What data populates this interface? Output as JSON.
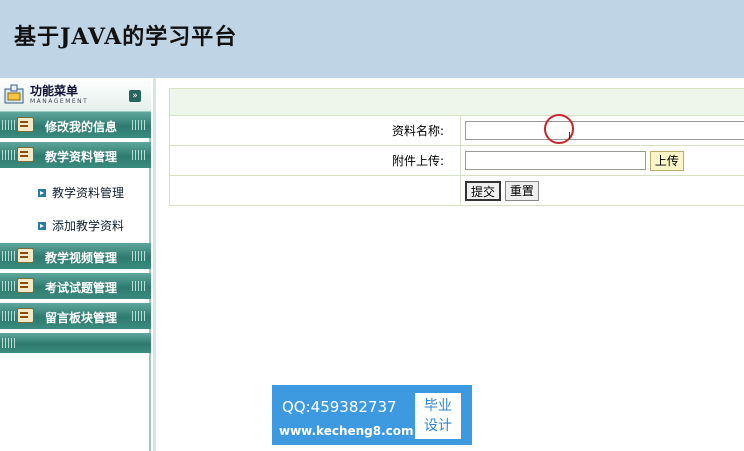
{
  "header": {
    "title": "基于JAVA的学习平台"
  },
  "menu": {
    "title": "功能菜单",
    "subtitle": "MANAGEMENT",
    "collapse_icon": "chevron-down-icon"
  },
  "sidebar": {
    "sections": [
      {
        "label": "修改我的信息"
      },
      {
        "label": "教学资料管理"
      },
      {
        "label": "教学视频管理"
      },
      {
        "label": "考试试题管理"
      },
      {
        "label": "留言板块管理"
      }
    ],
    "sub_items": [
      {
        "label": "教学资料管理"
      },
      {
        "label": "添加教学资料"
      }
    ]
  },
  "form": {
    "name_label": "资料名称:",
    "name_value": "",
    "attachment_label": "附件上传:",
    "attachment_value": "",
    "upload_button": "上传",
    "submit_button": "提交",
    "reset_button": "重置"
  },
  "watermark": {
    "qq": "QQ:459382737",
    "url": "www.kecheng8.com",
    "badge_line1": "毕业",
    "badge_line2": "设计"
  }
}
